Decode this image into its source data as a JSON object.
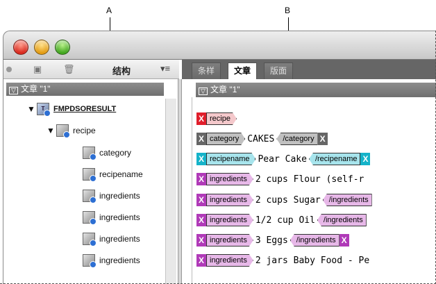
{
  "callouts": {
    "a_label": "A",
    "b_label": "B"
  },
  "toolbar": {
    "panel_title": "结构",
    "menu_icon": "list-menu-icon"
  },
  "structure": {
    "doc_label": "文章 \"1\"",
    "root_badge": "T",
    "root": "FMPDSORESULT",
    "recipe": "recipe",
    "children": [
      "category",
      "recipename",
      "ingredients",
      "ingredients",
      "ingredients",
      "ingredients"
    ]
  },
  "tabs": [
    "条样",
    "文章",
    "版面"
  ],
  "content": {
    "doc_label": "文章 \"1\"",
    "lines": [
      {
        "x": "X",
        "xcolor": "red",
        "tag": "recipe",
        "tagcolor": "red",
        "text": "",
        "close": "",
        "endx": ""
      },
      {
        "x": "X",
        "xcolor": "gray",
        "tag": "category",
        "tagcolor": "gray",
        "text": "CAKES",
        "close": "/category",
        "endx": "X"
      },
      {
        "x": "X",
        "xcolor": "cyan",
        "tag": "recipename",
        "tagcolor": "cyan",
        "text": "Pear Cake",
        "close": "/recipename",
        "endx": "X"
      },
      {
        "x": "X",
        "xcolor": "purple",
        "tag": "ingredients",
        "tagcolor": "purple",
        "text": "2 cups Flour (self-r",
        "close": "",
        "endx": ""
      },
      {
        "x": "X",
        "xcolor": "purple",
        "tag": "ingredients",
        "tagcolor": "purple",
        "text": "2 cups Sugar",
        "close": "/ingredients",
        "endx": ""
      },
      {
        "x": "X",
        "xcolor": "purple",
        "tag": "ingredients",
        "tagcolor": "purple",
        "text": "1/2 cup Oil",
        "close": "/ingredients",
        "endx": ""
      },
      {
        "x": "X",
        "xcolor": "purple",
        "tag": "ingredients",
        "tagcolor": "purple",
        "text": "3 Eggs",
        "close": "/ingredients",
        "endx": "X"
      },
      {
        "x": "X",
        "xcolor": "purple",
        "tag": "ingredients",
        "tagcolor": "purple",
        "text": "2 jars Baby Food - Pe",
        "close": "",
        "endx": ""
      }
    ]
  },
  "colors": {
    "red": "#e01e2b",
    "gray": "#666666",
    "cyan": "#15b3c9",
    "purple": "#b03ab8"
  }
}
